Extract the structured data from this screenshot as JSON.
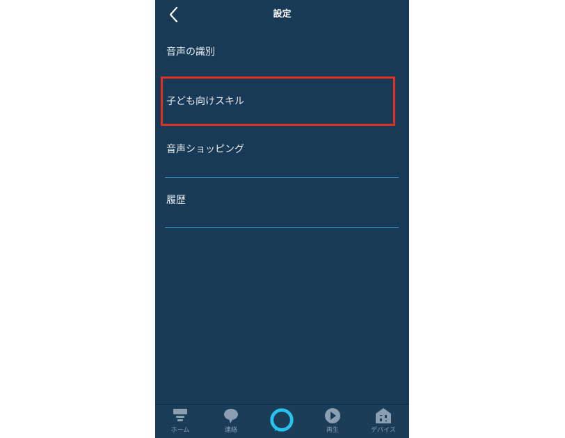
{
  "header": {
    "title": "設定"
  },
  "settings_rows": [
    {
      "label": "音声の識別"
    },
    {
      "label": "子ども向けスキル"
    },
    {
      "label": "音声ショッピング"
    },
    {
      "label": "履歴"
    }
  ],
  "tab_bar": {
    "items": [
      {
        "label": "ホーム",
        "icon": "home-icon"
      },
      {
        "label": "連絡",
        "icon": "chat-bubble-icon"
      },
      {
        "label": "",
        "icon": "alexa-ring-icon"
      },
      {
        "label": "再生",
        "icon": "play-icon"
      },
      {
        "label": "デバイス",
        "icon": "device-house-icon"
      }
    ]
  },
  "colors": {
    "background": "#183a56",
    "divider": "#3a8fc7",
    "highlight": "#e03020",
    "alexa_accent": "#29c3f0",
    "tab_inactive": "#8aa0b2"
  }
}
